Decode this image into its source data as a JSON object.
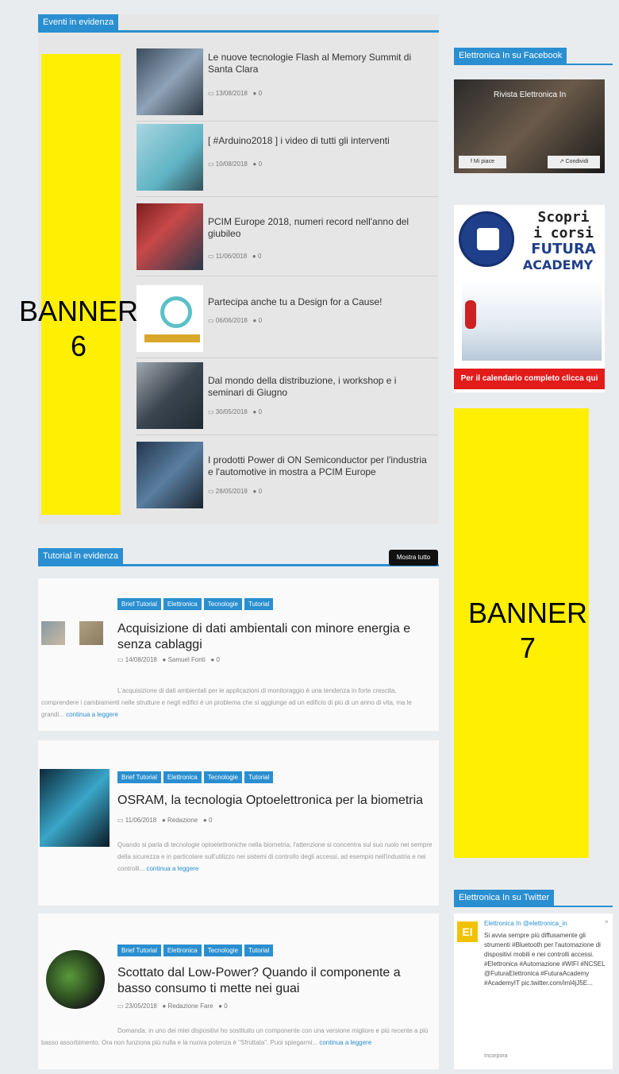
{
  "eventi": {
    "title": "Eventi in evidenza",
    "items": [
      {
        "title": "Le nuove tecnologie Flash al Memory Summit di Santa Clara",
        "date": "13/08/2018",
        "comments": "0"
      },
      {
        "title": "[ #Arduino2018 ] i video di tutti gli interventi",
        "date": "10/08/2018",
        "comments": "0"
      },
      {
        "title": "PCIM Europe 2018, numeri record nell'anno del giubileo",
        "date": "11/06/2018",
        "comments": "0"
      },
      {
        "title": "Partecipa anche tu a Design for a Cause!",
        "date": "06/06/2018",
        "comments": "0"
      },
      {
        "title": "Dal mondo della distribuzione, i workshop e i seminari di Giugno",
        "date": "30/05/2018",
        "comments": "0"
      },
      {
        "title": "I prodotti Power di ON Semiconductor per l'industria e l'automotive in mostra a PCIM Europe",
        "date": "28/05/2018",
        "comments": "0"
      }
    ]
  },
  "banner6": {
    "line1": "BANNER",
    "line2": "6"
  },
  "banner7": {
    "line1": "BANNER",
    "line2": "7"
  },
  "tutorial": {
    "title": "Tutorial in evidenza",
    "view_all": "Mostra tutto",
    "posts": [
      {
        "tags": [
          "Brief Tutorial",
          "Elettronica",
          "Tecnologie",
          "Tutorial"
        ],
        "title": "Acquisizione di dati ambientali con minore energia e senza cablaggi",
        "date": "14/08/2018",
        "author": "Samuel Fonti",
        "comments": "0",
        "excerpt": "L'acquisizione di dati ambientali per le applicazioni di monitoraggio è una tendenza in forte crescita, comprendere i cambiamenti nelle strutture e negli edifici è un problema che si aggiunge ad un edificio di più di un anno di vita, ma le grandi...",
        "more": "continua a leggere"
      },
      {
        "tags": [
          "Brief Tutorial",
          "Elettronica",
          "Tecnologie",
          "Tutorial"
        ],
        "title": "OSRAM, la tecnologia Optoelettronica per la biometria",
        "date": "11/06/2018",
        "author": "Redazione",
        "comments": "0",
        "excerpt": "Quando si parla di tecnologie optoelettroniche nella biometria, l'attenzione si concentra sul suo ruolo nei sempre della sicurezza e in particolare sull'utilizzo nei sistemi di controllo degli accessi, ad esempio nell'industria e nei controlli...",
        "more": "continua a leggere"
      },
      {
        "tags": [
          "Brief Tutorial",
          "Elettronica",
          "Tecnologie",
          "Tutorial"
        ],
        "title": "Scottato dal Low-Power? Quando il componente a basso consumo ti mette nei guai",
        "date": "23/05/2018",
        "author": "Redazione Fare",
        "comments": "0",
        "excerpt": "Domanda: in uno dei miei dispositivi ho sostituito un componente con una versione migliore e più recente a più basso assorbimento. Ora non funziona più nulla e la nuova potenza è \"Sfruttata\". Puoi spiegarmi...",
        "more": "continua a leggere"
      }
    ]
  },
  "facebook": {
    "title": "Elettronica In su Facebook",
    "page_name": "Rivista Elettronica In",
    "like": "Mi piace",
    "share": "Condividi"
  },
  "futura": {
    "line1": "Scopri",
    "line2": "i corsi",
    "line3": "FUTURA",
    "line4": "ACADEMY",
    "bar": "Per il calendario completo clicca qui"
  },
  "twitter": {
    "title": "Elettronica In su Twitter",
    "account": "Elettronica In @elettronica_in",
    "tweet": "Si avvia sempre più diffusamente gli strumenti #Bluetooth per l'automazione di dispositivi mobili e nei controlli accessi. #Elettronica #Automazione #WIFI #NCSEL @FuturaElettronica #FuturaAcademy #AcademyIT pic.twitter.com/iml4jJ5E...",
    "embed": "Incorpora"
  },
  "colors": {
    "accent": "#2a8fd0",
    "banner": "#ffef00",
    "futura_red": "#e21b1b"
  }
}
